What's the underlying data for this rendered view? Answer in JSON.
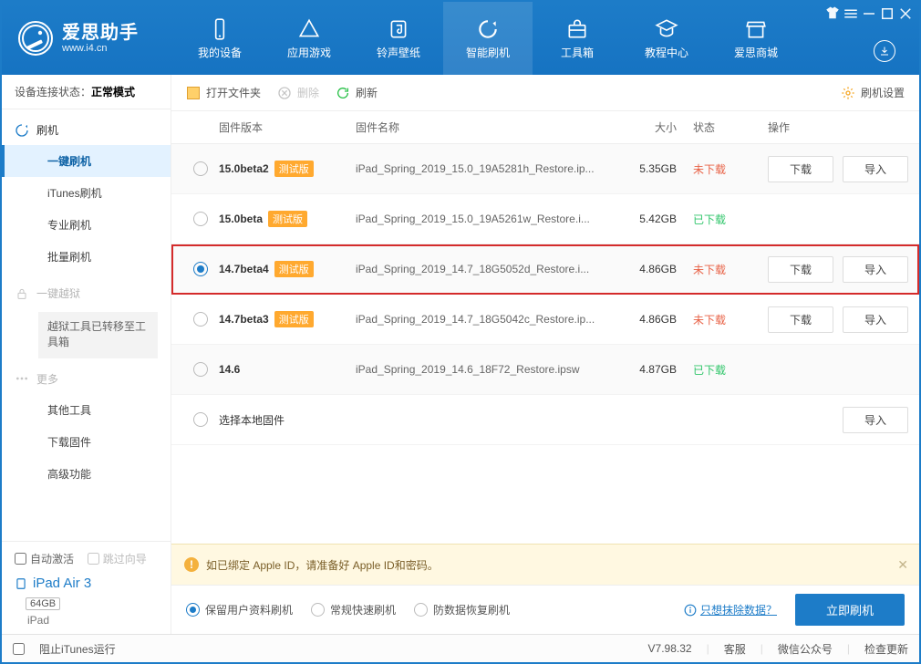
{
  "header": {
    "app_name": "爱思助手",
    "app_url": "www.i4.cn",
    "nav": [
      {
        "label": "我的设备"
      },
      {
        "label": "应用游戏"
      },
      {
        "label": "铃声壁纸"
      },
      {
        "label": "智能刷机"
      },
      {
        "label": "工具箱"
      },
      {
        "label": "教程中心"
      },
      {
        "label": "爱思商城"
      }
    ]
  },
  "sidebar": {
    "conn_label": "设备连接状态：",
    "conn_value": "正常模式",
    "flash_group": "刷机",
    "flash_items": [
      "一键刷机",
      "iTunes刷机",
      "专业刷机",
      "批量刷机"
    ],
    "jailbreak_group": "一键越狱",
    "jailbreak_notice": "越狱工具已转移至工具箱",
    "more_group": "更多",
    "more_items": [
      "其他工具",
      "下载固件",
      "高级功能"
    ],
    "auto_activate": "自动激活",
    "skip_guide": "跳过向导",
    "device_name": "iPad Air 3",
    "device_storage": "64GB",
    "device_model": "iPad"
  },
  "toolbar": {
    "open": "打开文件夹",
    "delete": "删除",
    "refresh": "刷新",
    "settings": "刷机设置"
  },
  "table": {
    "cols": {
      "ver": "固件版本",
      "name": "固件名称",
      "size": "大小",
      "status": "状态",
      "ops": "操作"
    },
    "badge_beta": "测试版",
    "download": "下载",
    "import": "导入",
    "st_not": "未下载",
    "st_done": "已下载",
    "local_row": "选择本地固件",
    "rows": [
      {
        "ver": "15.0beta2",
        "beta": true,
        "name": "iPad_Spring_2019_15.0_19A5281h_Restore.ip...",
        "size": "5.35GB",
        "status": "NOT",
        "ops": [
          "download",
          "import"
        ],
        "selected": false
      },
      {
        "ver": "15.0beta",
        "beta": true,
        "name": "iPad_Spring_2019_15.0_19A5261w_Restore.i...",
        "size": "5.42GB",
        "status": "DONE",
        "ops": [],
        "selected": false
      },
      {
        "ver": "14.7beta4",
        "beta": true,
        "name": "iPad_Spring_2019_14.7_18G5052d_Restore.i...",
        "size": "4.86GB",
        "status": "NOT",
        "ops": [
          "download",
          "import"
        ],
        "selected": true,
        "highlight": true
      },
      {
        "ver": "14.7beta3",
        "beta": true,
        "name": "iPad_Spring_2019_14.7_18G5042c_Restore.ip...",
        "size": "4.86GB",
        "status": "NOT",
        "ops": [
          "download",
          "import"
        ],
        "selected": false
      },
      {
        "ver": "14.6",
        "beta": false,
        "name": "iPad_Spring_2019_14.6_18F72_Restore.ipsw",
        "size": "4.87GB",
        "status": "DONE",
        "ops": [],
        "selected": false
      }
    ]
  },
  "warn_text": "如已绑定 Apple ID，请准备好 Apple ID和密码。",
  "options": {
    "keep": "保留用户资料刷机",
    "normal": "常规快速刷机",
    "anti": "防数据恢复刷机",
    "erase_link": "只想抹除数据？",
    "flash": "立即刷机"
  },
  "status": {
    "itunes_block": "阻止iTunes运行",
    "version": "V7.98.32",
    "cs": "客服",
    "wechat": "微信公众号",
    "update": "检查更新"
  }
}
